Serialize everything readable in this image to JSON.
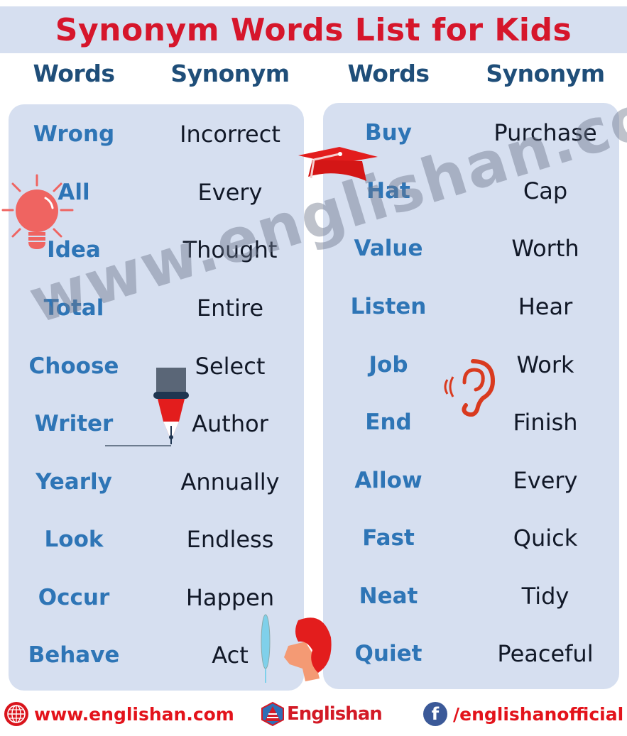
{
  "title": "Synonym Words List for Kids",
  "headers": {
    "left_words": "Words",
    "left_synonym": "Synonym",
    "right_words": "Words",
    "right_synonym": "Synonym"
  },
  "left_pairs": [
    {
      "word": "Wrong",
      "synonym": "Incorrect"
    },
    {
      "word": "All",
      "synonym": "Every"
    },
    {
      "word": "Idea",
      "synonym": "Thought"
    },
    {
      "word": "Total",
      "synonym": "Entire"
    },
    {
      "word": "Choose",
      "synonym": "Select"
    },
    {
      "word": "Writer",
      "synonym": "Author"
    },
    {
      "word": "Yearly",
      "synonym": "Annually"
    },
    {
      "word": "Look",
      "synonym": "Endless"
    },
    {
      "word": "Occur",
      "synonym": "Happen"
    },
    {
      "word": "Behave",
      "synonym": "Act"
    }
  ],
  "right_pairs": [
    {
      "word": "Buy",
      "synonym": "Purchase"
    },
    {
      "word": "Hat",
      "synonym": "Cap"
    },
    {
      "word": "Value",
      "synonym": "Worth"
    },
    {
      "word": "Listen",
      "synonym": "Hear"
    },
    {
      "word": "Job",
      "synonym": "Work"
    },
    {
      "word": "End",
      "synonym": "Finish"
    },
    {
      "word": "Allow",
      "synonym": "Every"
    },
    {
      "word": "Fast",
      "synonym": "Quick"
    },
    {
      "word": "Neat",
      "synonym": "Tidy"
    },
    {
      "word": "Quiet",
      "synonym": "Peaceful"
    }
  ],
  "watermark": "www.englishan.com",
  "footer": {
    "website": "www.englishan.com",
    "logo_text": "Englishan",
    "facebook": "/englishanofficial",
    "facebook_glyph": "f"
  },
  "colors": {
    "title": "#d6162b",
    "header": "#1f4e79",
    "word": "#2e75b6",
    "synonym": "#111827",
    "panel": "#d6dff0",
    "footer": "#e3131b"
  }
}
